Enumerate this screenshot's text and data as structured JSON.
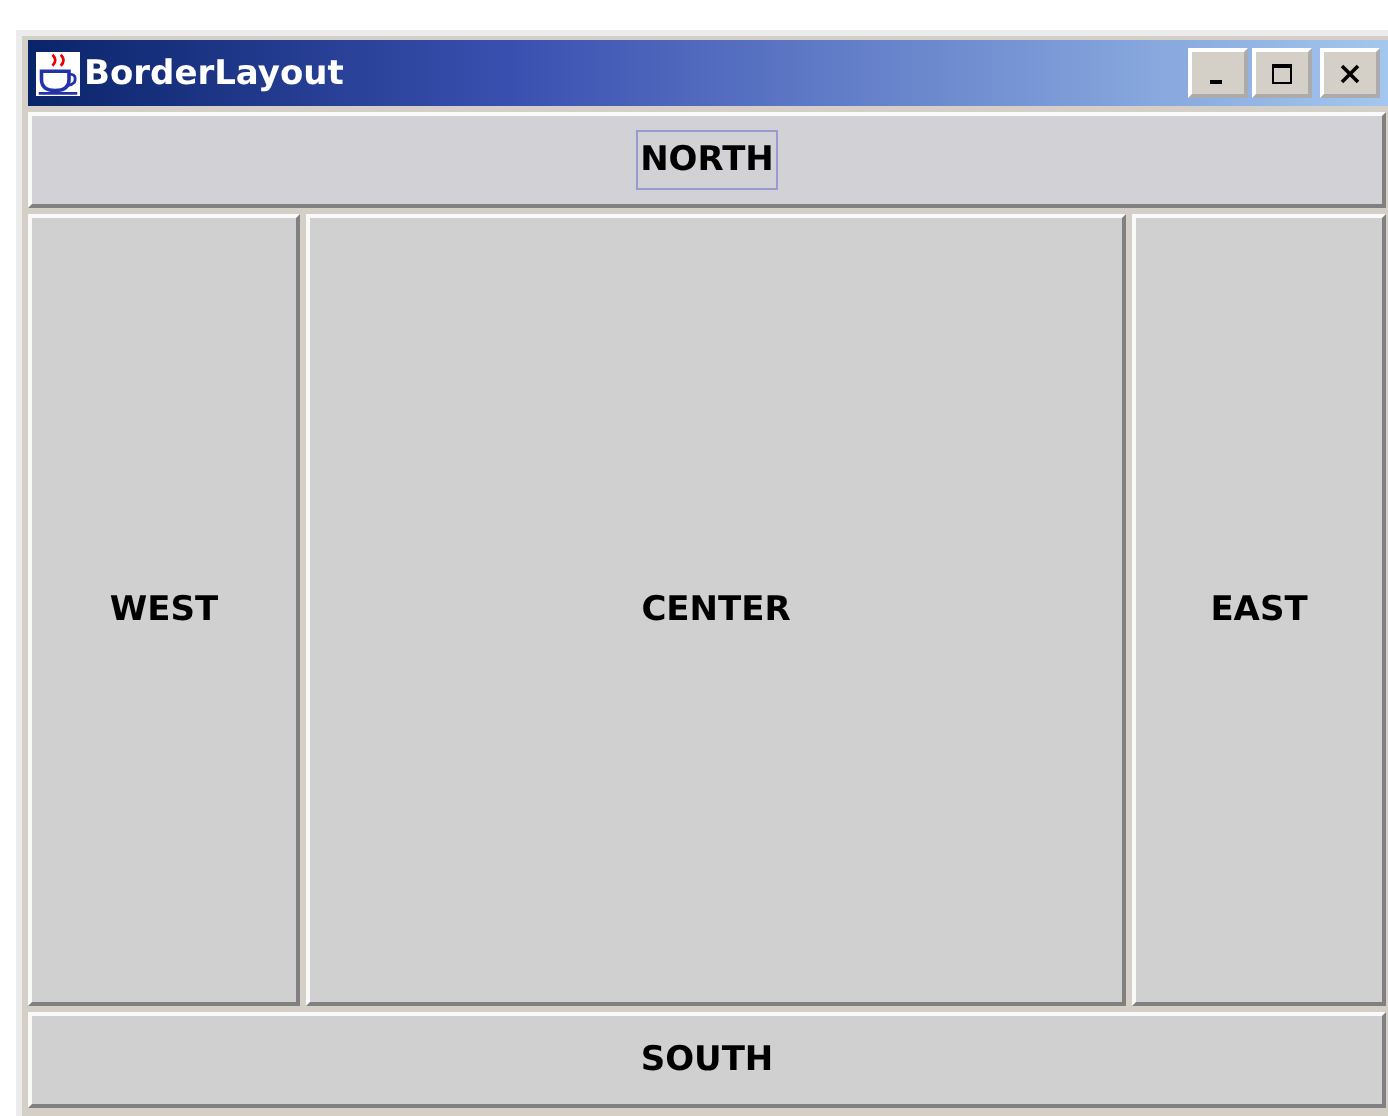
{
  "window": {
    "title": "BorderLayout"
  },
  "buttons": [
    {
      "label": "NORTH",
      "focused": true
    },
    {
      "label": "WEST",
      "focused": false
    },
    {
      "label": "CENTER",
      "focused": false
    },
    {
      "label": "EAST",
      "focused": false
    },
    {
      "label": "SOUTH",
      "focused": false
    }
  ]
}
